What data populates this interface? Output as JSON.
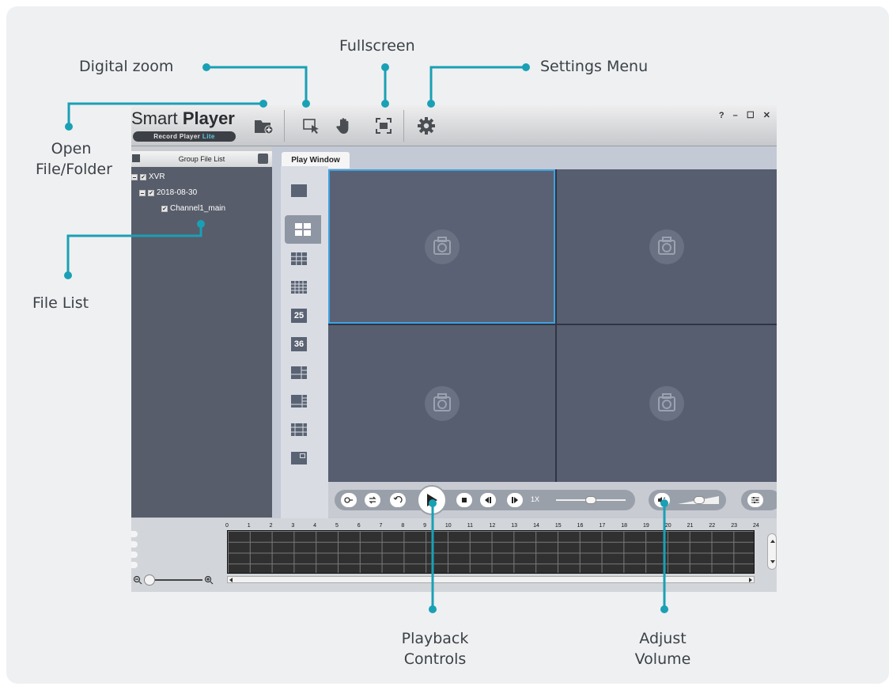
{
  "annotations": {
    "digital_zoom": "Digital zoom",
    "fullscreen": "Fullscreen",
    "settings_menu": "Settings Menu",
    "open_file_line1": "Open",
    "open_file_line2": "File/Folder",
    "file_list": "File List",
    "playback_line1": "Playback",
    "playback_line2": "Controls",
    "volume_line1": "Adjust",
    "volume_line2": "Volume",
    "callout_color": "#1aa0b5"
  },
  "app": {
    "logo_smart": "Smart",
    "logo_player": "Player",
    "logo_pill_main": "Record Player",
    "logo_pill_lite": "Lite",
    "toolbar_icons": [
      "open-folder-icon",
      "digital-zoom-icon",
      "hand-pan-icon",
      "fullscreen-icon",
      "settings-gear-icon"
    ],
    "window_controls": "? – ☐ ✕",
    "file_list_header": "Group File List",
    "tree": {
      "root": "XVR",
      "date": "2018-08-30",
      "channel": "Channel1_main"
    },
    "play_window_tab": "Play Window",
    "layout_numbers": {
      "n25": "25",
      "n36": "36"
    },
    "speed": "1X",
    "speed_level": 0.5,
    "volume_level": 0.6,
    "timeline_hours": [
      "0",
      "1",
      "2",
      "3",
      "4",
      "5",
      "6",
      "7",
      "8",
      "9",
      "10",
      "11",
      "12",
      "13",
      "14",
      "15",
      "16",
      "17",
      "18",
      "19",
      "20",
      "21",
      "22",
      "23",
      "24"
    ]
  }
}
